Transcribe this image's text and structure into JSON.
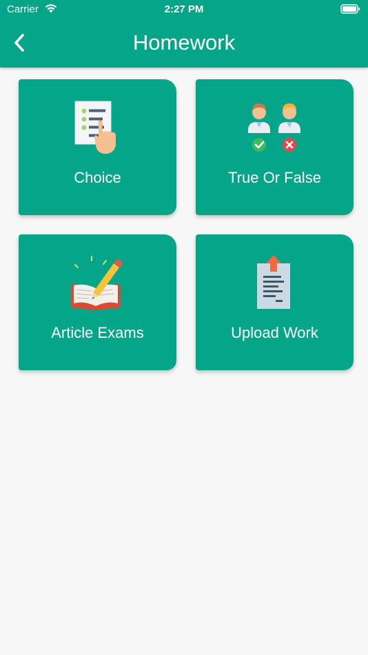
{
  "status_bar": {
    "carrier": "Carrier",
    "time": "2:27 PM"
  },
  "header": {
    "title": "Homework",
    "back_icon": "chevron-left-icon"
  },
  "colors": {
    "primary": "#05a58a",
    "background": "#f7f7f7",
    "text_on_primary": "#ffffff"
  },
  "cards": [
    {
      "label": "Choice",
      "icon": "choice-list-icon"
    },
    {
      "label": "True Or False",
      "icon": "true-false-icon"
    },
    {
      "label": "Article Exams",
      "icon": "book-pencil-icon"
    },
    {
      "label": "Upload Work",
      "icon": "upload-document-icon"
    }
  ]
}
